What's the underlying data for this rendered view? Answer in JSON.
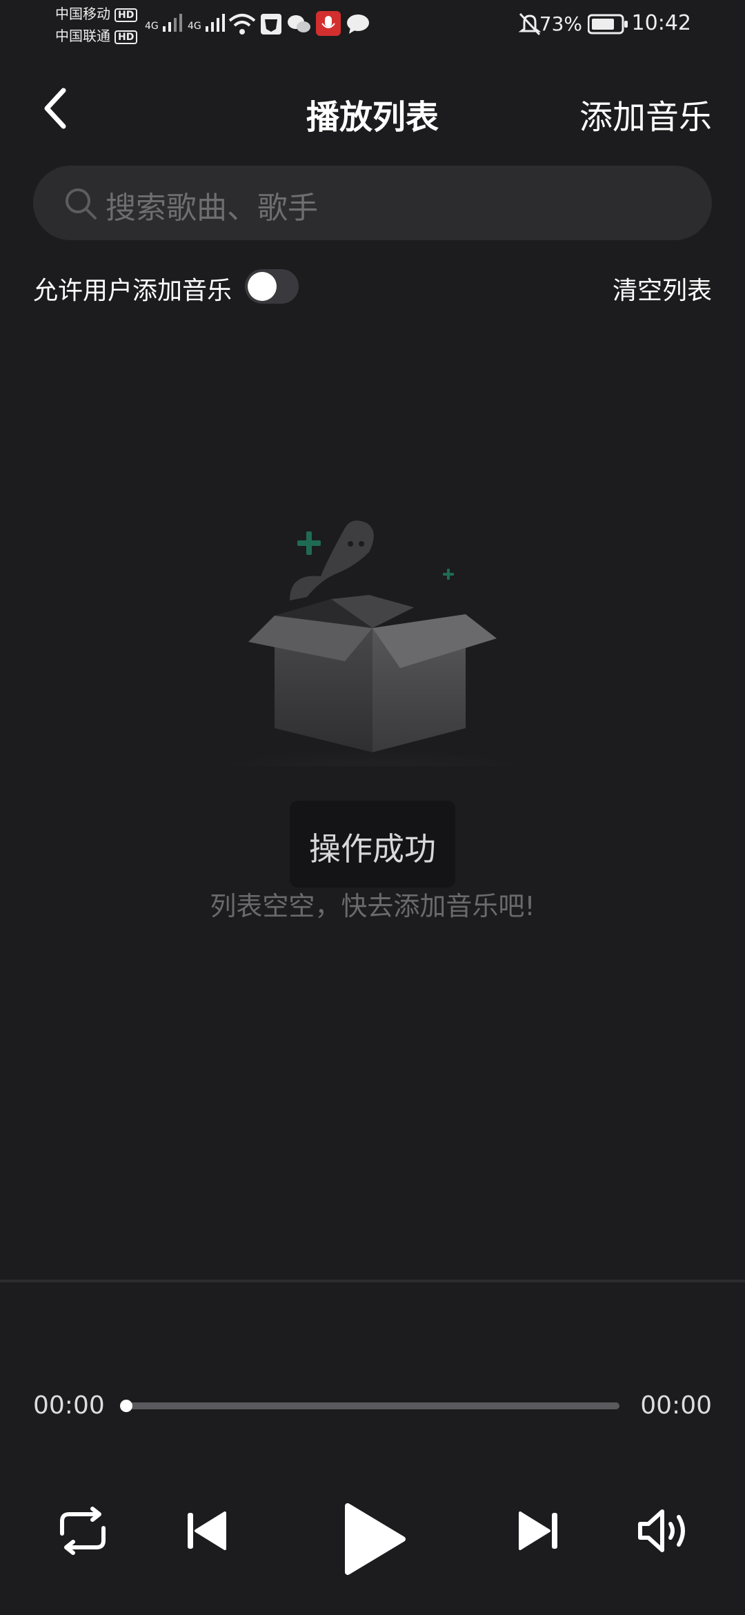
{
  "status_bar": {
    "carrier1": "中国移动",
    "carrier2": "中国联通",
    "hd": "HD",
    "net1": "4G",
    "net2": "4G",
    "battery": "73%",
    "time": "10:42"
  },
  "header": {
    "title": "播放列表",
    "add_music": "添加音乐"
  },
  "search": {
    "placeholder": "搜索歌曲、歌手"
  },
  "options": {
    "allow_label": "允许用户添加音乐",
    "allow_enabled": false,
    "clear_label": "清空列表"
  },
  "empty_state": {
    "toast": "操作成功",
    "message": "列表空空，快去添加音乐吧!"
  },
  "player": {
    "current_time": "00:00",
    "total_time": "00:00",
    "progress": 0,
    "controls": [
      "repeat-icon",
      "previous-icon",
      "play-icon",
      "next-icon",
      "volume-icon"
    ]
  },
  "colors": {
    "background": "#1c1c1e",
    "accent_green": "#1f6b52"
  }
}
